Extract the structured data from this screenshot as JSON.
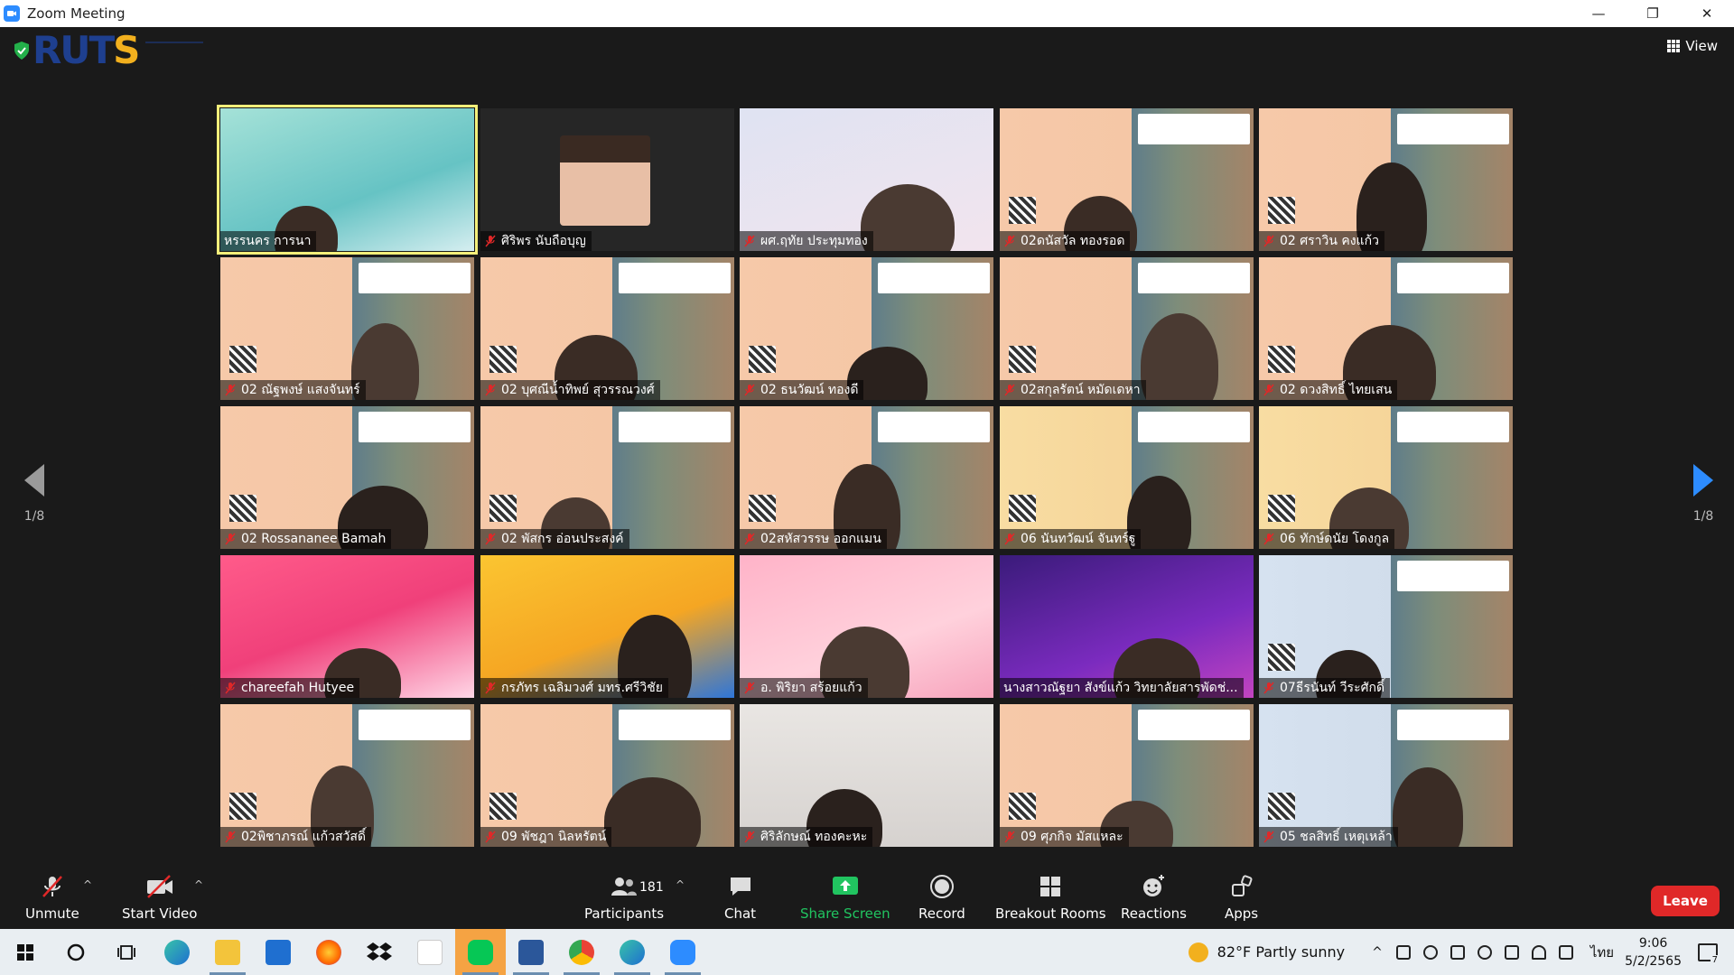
{
  "window": {
    "title": "Zoom Meeting",
    "controls": [
      "—",
      "❐",
      "✕"
    ]
  },
  "header": {
    "logo_main": "RUT",
    "logo_accent": "S",
    "view_label": "View"
  },
  "pagination": {
    "left": "1/8",
    "right": "1/8"
  },
  "participants": [
    {
      "name": "หรรนคร การนา",
      "bg": "teal",
      "muted": false,
      "active": true
    },
    {
      "name": "ศิริพร นับถือบุญ",
      "bg": "dark",
      "muted": true
    },
    {
      "name": "ผศ.ฤทัย ประทุมทอง",
      "bg": "light",
      "muted": true
    },
    {
      "name": "02ดนัสวัล ทองรอด",
      "bg": "slide",
      "muted": true
    },
    {
      "name": "02 ศราวิน คงแก้ว",
      "bg": "slide",
      "muted": true
    },
    {
      "name": "02 ณัฐพงษ์ แสงจันทร์",
      "bg": "slide",
      "muted": true
    },
    {
      "name": "02 บุศณีน้ำทิพย์ สุวรรณวงศ์",
      "bg": "slide",
      "muted": true
    },
    {
      "name": "02 ธนวัฒน์ ทองดี",
      "bg": "slide",
      "muted": true
    },
    {
      "name": "02สกุลรัตน์ หมัดเดหา",
      "bg": "slide",
      "muted": true
    },
    {
      "name": "02 ดวงสิทธิ์ ไทยเสน",
      "bg": "slide",
      "muted": true
    },
    {
      "name": "02 Rossananee Bamah",
      "bg": "slide",
      "muted": true
    },
    {
      "name": "02 พัสกร อ่อนประสงค์",
      "bg": "slide",
      "muted": true
    },
    {
      "name": "02สหัสวรรษ ออกแมน",
      "bg": "slide",
      "muted": true
    },
    {
      "name": "06 นันทวัฒน์ จันทร์ฐู",
      "bg": "slide-y",
      "muted": true
    },
    {
      "name": "06 ทักษ์ดนัย โดงกูล",
      "bg": "slide-y",
      "muted": true
    },
    {
      "name": "chareefah Hutyee",
      "bg": "pink",
      "muted": true
    },
    {
      "name": "กรภัทร เฉลิมวงศ์ มทร.ศรีวิชัย",
      "bg": "yellow",
      "muted": true
    },
    {
      "name": "อ. พิริยา สร้อยแก้ว",
      "bg": "rose",
      "muted": true
    },
    {
      "name": "นางสาวณัฐยา สังข์แก้ว วิทยาลัยสารพัดช่...",
      "bg": "purple",
      "muted": false
    },
    {
      "name": "07ธีรนันท์ วีระศักดิ์",
      "bg": "slide-b",
      "muted": true
    },
    {
      "name": "02พิชาภรณ์ แก้วสวัสดิ์",
      "bg": "slide",
      "muted": true
    },
    {
      "name": "09 พัชฎา นิลหรัตน์",
      "bg": "slide",
      "muted": true
    },
    {
      "name": "ศิริลักษณ์ ทองคะหะ",
      "bg": "room",
      "muted": true
    },
    {
      "name": "09 ศุภกิจ มัสแหละ",
      "bg": "slide",
      "muted": true
    },
    {
      "name": "05 ชลสิทธิ์ เหตุเหล้า",
      "bg": "slide-b",
      "muted": true
    }
  ],
  "toolbar": {
    "unmute": "Unmute",
    "start_video": "Start Video",
    "participant_count": "181",
    "participants": "Participants",
    "chat": "Chat",
    "share_screen": "Share Screen",
    "record": "Record",
    "breakout_rooms": "Breakout Rooms",
    "reactions": "Reactions",
    "apps": "Apps",
    "leave": "Leave"
  },
  "taskbar": {
    "weather": "82°F Partly sunny",
    "language": "ไทย",
    "time": "9:06",
    "date": "5/2/2565",
    "notifications": "7"
  },
  "colors": {
    "accent": "#2d8cff",
    "share": "#21c460",
    "leave": "#e02828",
    "active_speaker": "#f4ef7a"
  }
}
